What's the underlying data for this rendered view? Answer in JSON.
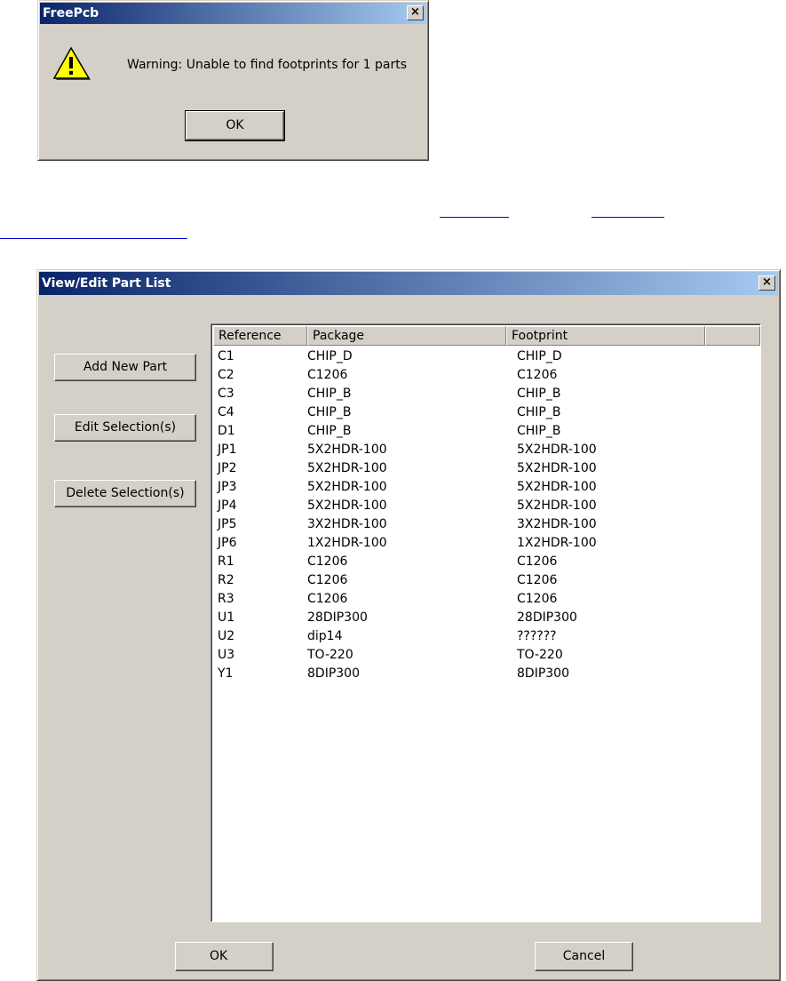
{
  "warning_dialog": {
    "title": "FreePcb",
    "close_label": "×",
    "icon": "warning-icon",
    "message": "Warning: Unable to find footprints for 1 parts",
    "ok_label": "OK"
  },
  "part_list_dialog": {
    "title": "View/Edit Part List",
    "close_label": "×",
    "buttons": {
      "add_new_part": "Add New Part",
      "edit_selection": "Edit Selection(s)",
      "delete_selection": "Delete Selection(s)",
      "ok": "OK",
      "cancel": "Cancel"
    },
    "columns": [
      "Reference",
      "Package",
      "Footprint"
    ],
    "rows": [
      [
        "C1",
        "CHIP_D",
        "CHIP_D"
      ],
      [
        "C2",
        "C1206",
        "C1206"
      ],
      [
        "C3",
        "CHIP_B",
        "CHIP_B"
      ],
      [
        "C4",
        "CHIP_B",
        "CHIP_B"
      ],
      [
        "D1",
        "CHIP_B",
        "CHIP_B"
      ],
      [
        "JP1",
        "5X2HDR-100",
        "5X2HDR-100"
      ],
      [
        "JP2",
        "5X2HDR-100",
        "5X2HDR-100"
      ],
      [
        "JP3",
        "5X2HDR-100",
        "5X2HDR-100"
      ],
      [
        "JP4",
        "5X2HDR-100",
        "5X2HDR-100"
      ],
      [
        "JP5",
        "3X2HDR-100",
        "3X2HDR-100"
      ],
      [
        "JP6",
        "1X2HDR-100",
        "1X2HDR-100"
      ],
      [
        "R1",
        "C1206",
        "C1206"
      ],
      [
        "R2",
        "C1206",
        "C1206"
      ],
      [
        "R3",
        "C1206",
        "C1206"
      ],
      [
        "U1",
        "28DIP300",
        "28DIP300"
      ],
      [
        "U2",
        "dip14",
        "??????"
      ],
      [
        "U3",
        "TO-220",
        "TO-220"
      ],
      [
        "Y1",
        "8DIP300",
        "8DIP300"
      ]
    ]
  },
  "colors": {
    "dialog_face": "#d4d0c8",
    "titlebar_start": "#0a246a",
    "titlebar_end": "#a6caf0",
    "link": "#0000cc"
  }
}
